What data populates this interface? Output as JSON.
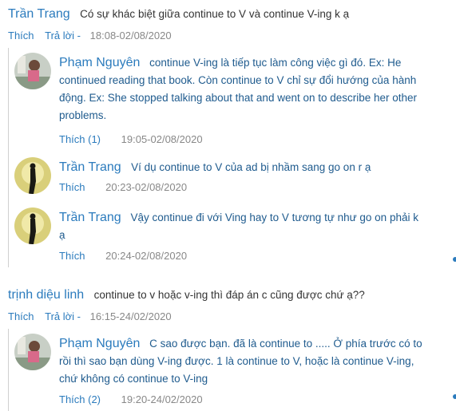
{
  "comments": [
    {
      "author": "Trần Trang",
      "text": "Có sự khác biệt giữa continue to V và continue V-ing k ạ",
      "like_label": "Thích",
      "reply_label": "Trả lời -",
      "time": "18:08-02/08/2020",
      "replies": [
        {
          "author": "Phạm Nguyên",
          "avatar": "kid-avatar",
          "text": "continue V-ing là tiếp tục làm công việc gì đó. Ex: He continued reading that book. Còn continue to V chỉ sự đổi hướng của hành động. Ex: She stopped talking about that and went on to describe her other problems.",
          "like_label": "Thích (1)",
          "time": "19:05-02/08/2020"
        },
        {
          "author": "Trần Trang",
          "avatar": "silhouette-avatar",
          "text": "Ví dụ continue to V của ad bị nhầm sang go on r ạ",
          "like_label": "Thích",
          "time": "20:23-02/08/2020"
        },
        {
          "author": "Trần Trang",
          "avatar": "silhouette-avatar",
          "text": "Vậy continue đi với Ving hay to V tương tự như go on phải k ạ",
          "like_label": "Thích",
          "time": "20:24-02/08/2020"
        }
      ]
    },
    {
      "author": "trịnh diệu linh",
      "text": "continue to v hoặc v-ing thì đáp án c cũng được chứ ạ??",
      "like_label": "Thích",
      "reply_label": "Trả lời -",
      "time": "16:15-24/02/2020",
      "replies": [
        {
          "author": "Phạm Nguyên",
          "avatar": "kid-avatar",
          "text": "C sao được bạn. đã là continue to ..... Ở phía trước có to rồi thì sao bạn dùng V-ing được. 1 là continue to V, hoặc là continue V-ing, chứ không có continue to V-ing",
          "like_label": "Thích (2)",
          "time": "19:20-24/02/2020"
        }
      ]
    }
  ]
}
